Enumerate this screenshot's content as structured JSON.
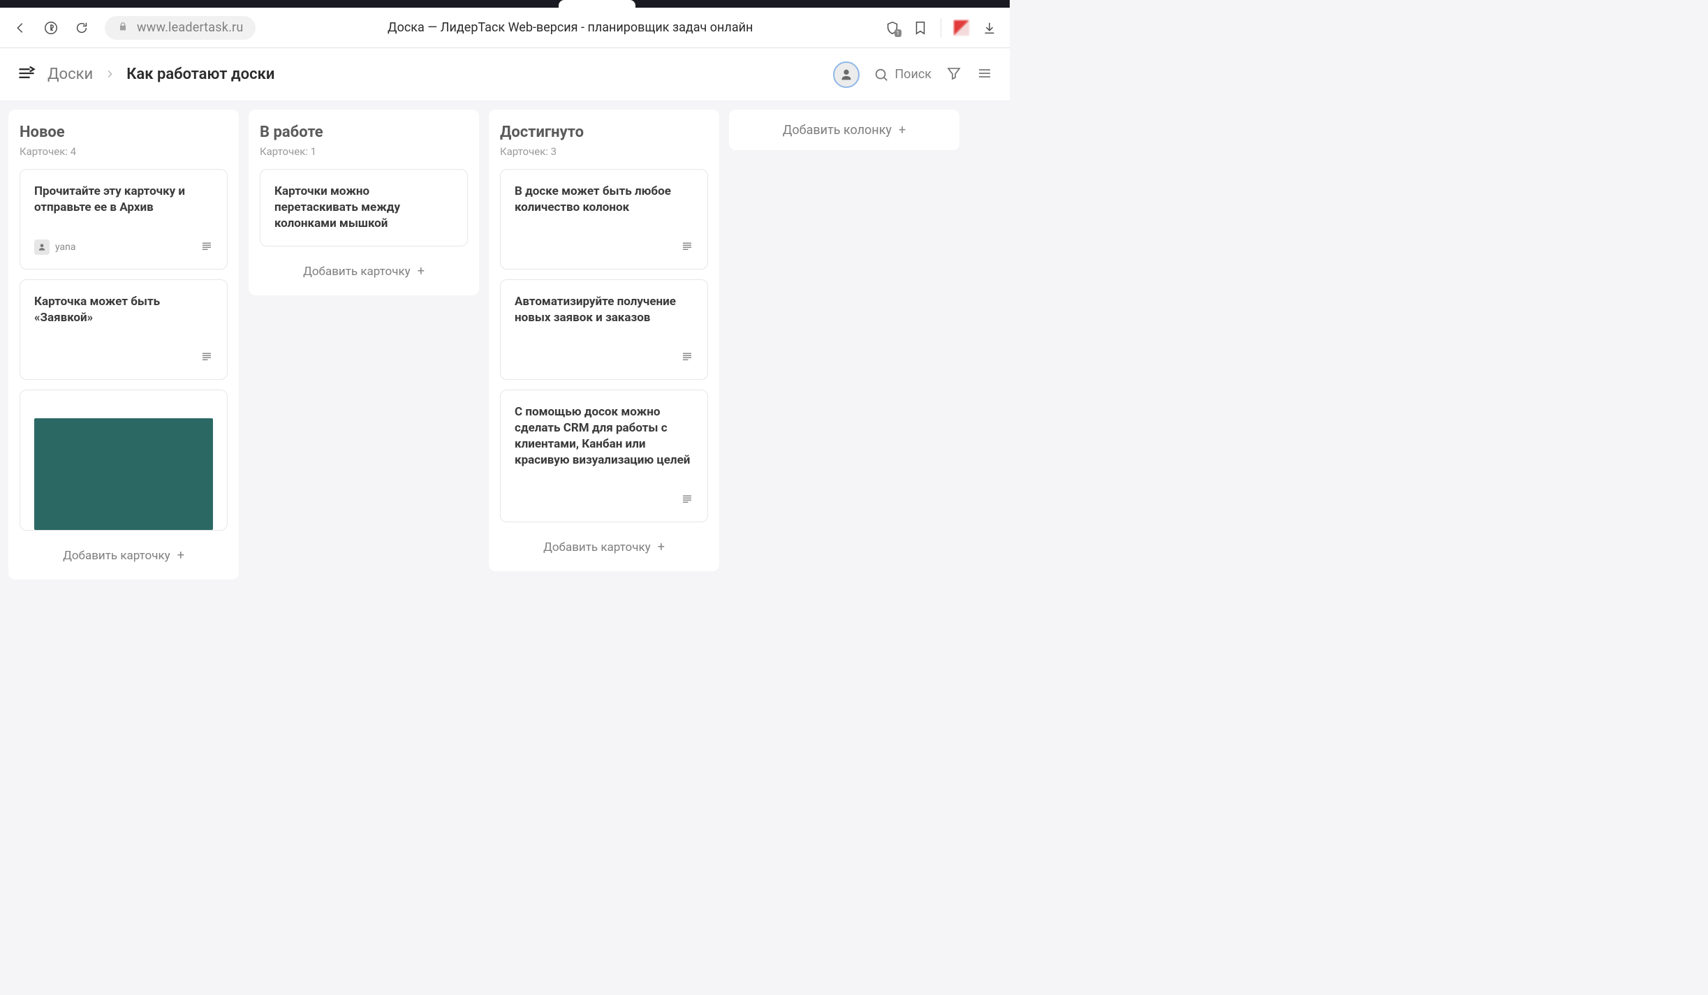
{
  "browser": {
    "url_display": "www.leadertask.ru",
    "page_title": "Доска — ЛидерТаск Web-версия - планировщик задач онлайн",
    "shield_count": "1"
  },
  "header": {
    "crumb_root": "Доски",
    "crumb_leaf": "Как работают доски",
    "search_label": "Поиск"
  },
  "board": {
    "add_column_label": "Добавить колонку",
    "add_card_label": "Добавить карточку",
    "card_count_prefix": "Карточек:",
    "columns": [
      {
        "title": "Новое",
        "count": "4",
        "cards": [
          {
            "title": "Прочитайте эту карточку и отправьте ее в Архив",
            "has_desc": true,
            "assignee": "yana"
          },
          {
            "title": "Карточка может быть «Заявкой»",
            "has_desc": true
          },
          {
            "title": "",
            "has_image": true
          }
        ]
      },
      {
        "title": "В работе",
        "count": "1",
        "cards": [
          {
            "title": "Карточки можно перетаскивать между колонками мышкой",
            "has_desc": false
          }
        ]
      },
      {
        "title": "Достигнуто",
        "count": "3",
        "cards": [
          {
            "title": "В доске может быть любое количество колонок",
            "has_desc": true
          },
          {
            "title": "Автоматизируйте получение новых заявок и заказов",
            "has_desc": true
          },
          {
            "title": "С помощью досок можно сделать CRM для работы с клиентами, Канбан или красивую визуализацию целей",
            "has_desc": true
          }
        ]
      }
    ]
  }
}
